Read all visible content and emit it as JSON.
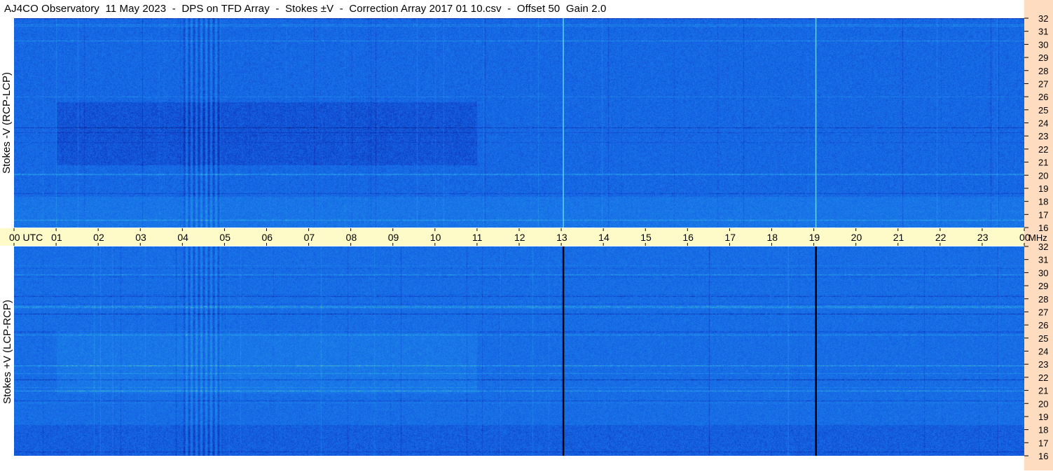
{
  "title": "AJ4CO Observatory  11 May 2023  -  DPS on TFD Array  -  Stokes ±V  -  Correction Array 2017 01 10.csv  -  Offset 50  Gain 2.0",
  "chart_data": {
    "type": "heatmap",
    "panels": [
      {
        "ylabel": "Stokes -V (RCP-LCP)",
        "ylim": [
          16,
          32
        ]
      },
      {
        "ylabel": "Stokes +V (LCP-RCP)",
        "ylim": [
          16,
          32
        ]
      }
    ],
    "x_ticks": [
      "00 UTC",
      "01",
      "02",
      "03",
      "04",
      "05",
      "06",
      "07",
      "08",
      "09",
      "10",
      "11",
      "12",
      "13",
      "14",
      "15",
      "16",
      "17",
      "18",
      "19",
      "20",
      "21",
      "22",
      "23",
      "00"
    ],
    "xlim": [
      0,
      24
    ],
    "y_ticks": [
      "32",
      "31",
      "30",
      "29",
      "28",
      "27",
      "26",
      "25",
      "24",
      "23",
      "22",
      "21",
      "20",
      "19",
      "18",
      "17",
      "16"
    ],
    "y_unit_label": "MHz",
    "colorscale": [
      "#0a0a3a",
      "#0d2fb4",
      "#1565e6",
      "#1e88e8",
      "#2fb7e6",
      "#8ee07a",
      "#f2e94a",
      "#e8523a"
    ],
    "axis_band_color": "#fffbc8",
    "right_strip_color": "#fddcc0",
    "vertical_lines_utc": [
      13.05,
      19.05
    ]
  }
}
